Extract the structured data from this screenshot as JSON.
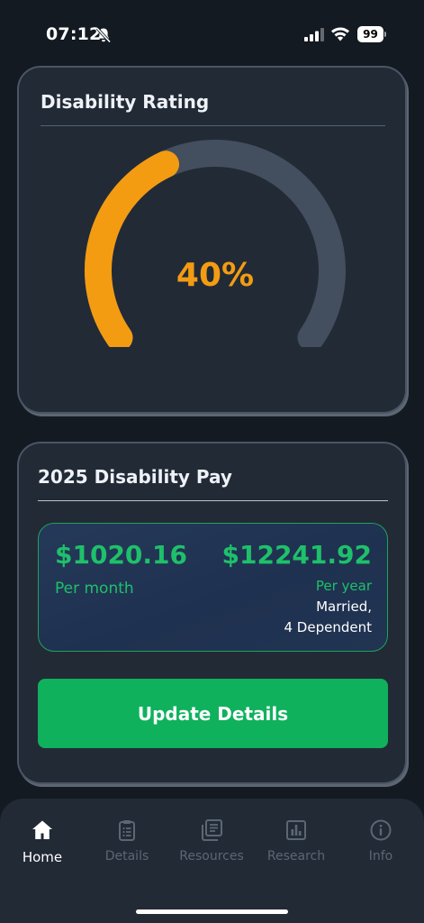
{
  "status": {
    "time": "07:12",
    "battery": "99",
    "icons": [
      "bell-slash-icon",
      "signal-icon",
      "wifi-icon",
      "battery-icon"
    ]
  },
  "rating_card": {
    "title": "Disability Rating",
    "value_text": "40%",
    "percent": 40,
    "colors": {
      "fill": "#f39c12",
      "track": "#434e5e"
    }
  },
  "pay_card": {
    "title": "2025 Disability Pay",
    "monthly_amount": "$1020.16",
    "monthly_label": "Per month",
    "yearly_amount": "$12241.92",
    "yearly_label": "Per year",
    "marital_status": "Married,",
    "dependents": "4 Dependent",
    "button_label": "Update Details",
    "colors": {
      "accent": "#1ec06a",
      "button": "#0fb15d"
    }
  },
  "tab_bar": {
    "tabs": [
      {
        "label": "Home",
        "icon": "home-icon",
        "active": true
      },
      {
        "label": "Details",
        "icon": "clipboard-icon",
        "active": false
      },
      {
        "label": "Resources",
        "icon": "documents-icon",
        "active": false
      },
      {
        "label": "Research",
        "icon": "bar-chart-icon",
        "active": false
      },
      {
        "label": "Info",
        "icon": "info-icon",
        "active": false
      }
    ]
  }
}
